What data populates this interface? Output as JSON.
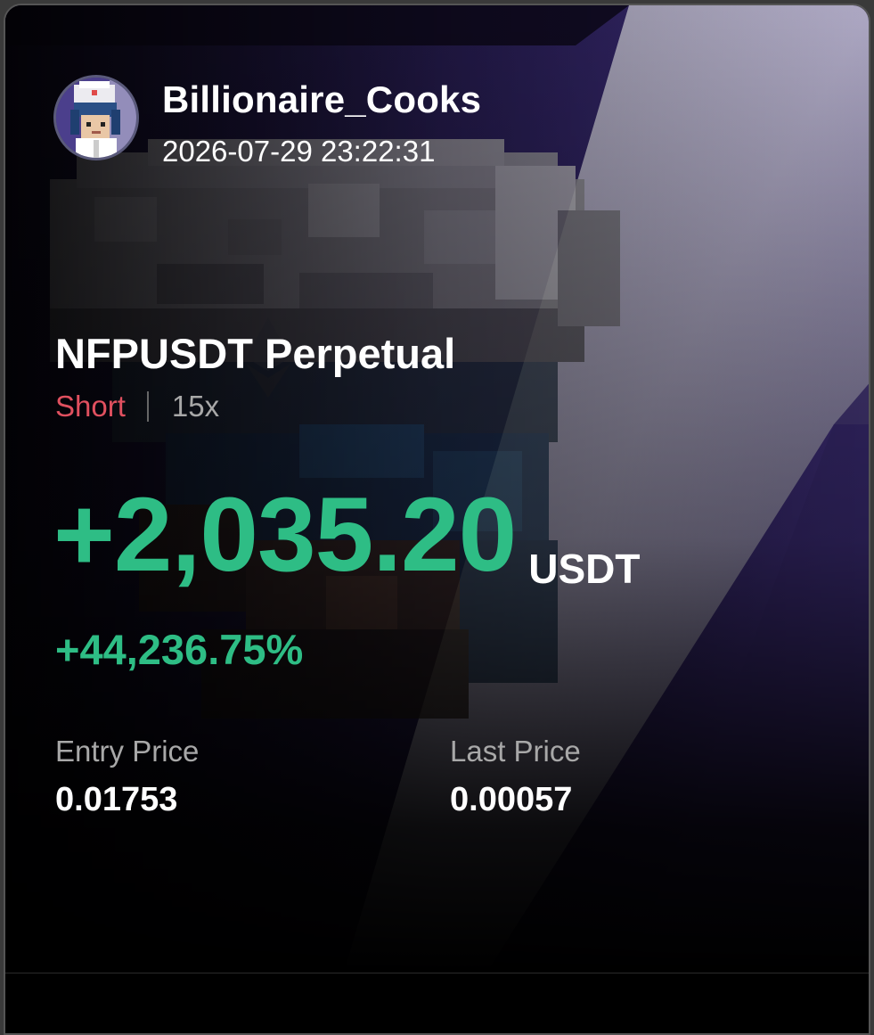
{
  "user": {
    "name": "Billionaire_Cooks",
    "timestamp": "2026-07-29 23:22:31",
    "avatar_icon": "chef-avatar-icon"
  },
  "position": {
    "pair": "NFPUSDT Perpetual",
    "side": "Short",
    "leverage": "15x"
  },
  "pnl": {
    "amount": "+2,035.20",
    "unit": "USDT",
    "roi": "+44,236.75%"
  },
  "prices": {
    "entry_label": "Entry Price",
    "entry_value": "0.01753",
    "last_label": "Last Price",
    "last_value": "0.00057"
  },
  "colors": {
    "profit": "#2ebd85",
    "short": "#e0505f",
    "accent_purple": "#3c2a7a"
  }
}
